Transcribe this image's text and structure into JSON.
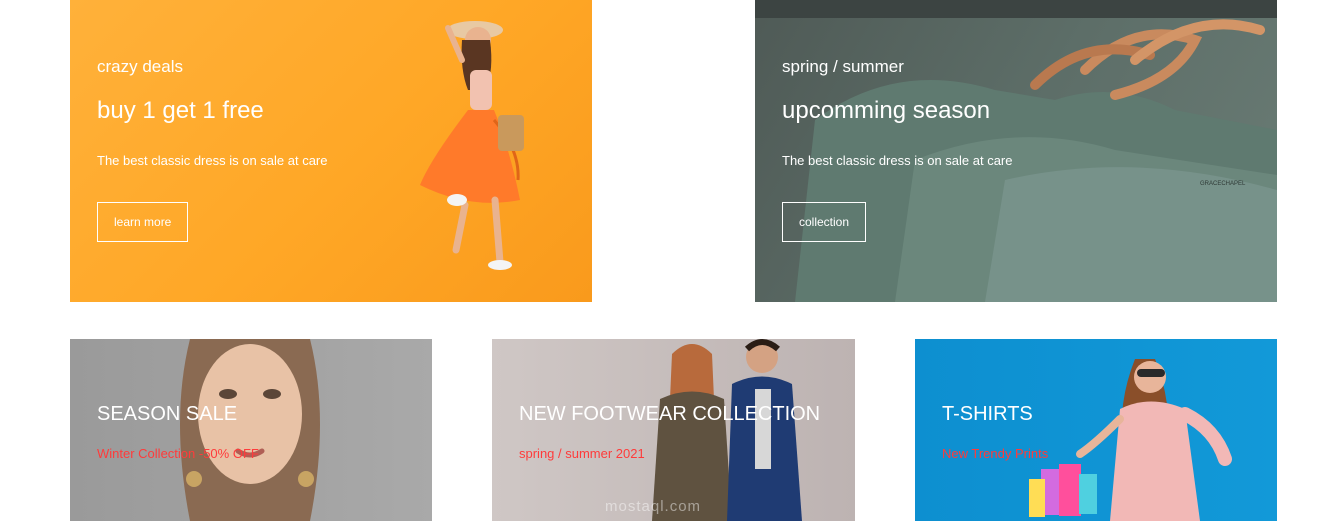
{
  "banners": [
    {
      "kicker": "crazy deals",
      "headline": "buy 1 get 1 free",
      "description": "The best classic dress is on sale at care",
      "button_label": "learn more"
    },
    {
      "kicker": "spring / summer",
      "headline": "upcomming season",
      "description": "The best classic dress is on sale at care",
      "button_label": "collection"
    }
  ],
  "categories": [
    {
      "title": "SEASON SALE",
      "subtitle": "Winter Collection -50% OFF"
    },
    {
      "title": "NEW FOOTWEAR COLLECTION",
      "subtitle": "spring / summer 2021"
    },
    {
      "title": "T-SHIRTS",
      "subtitle": "New Trendy Prints"
    }
  ],
  "watermark": "mostaql.com",
  "colors": {
    "banner1_bg": "#ffa726",
    "banner2_bg": "#5d6e68",
    "category_subtitle": "#ff3b3b",
    "tshirts_bg": "#1299d8"
  }
}
